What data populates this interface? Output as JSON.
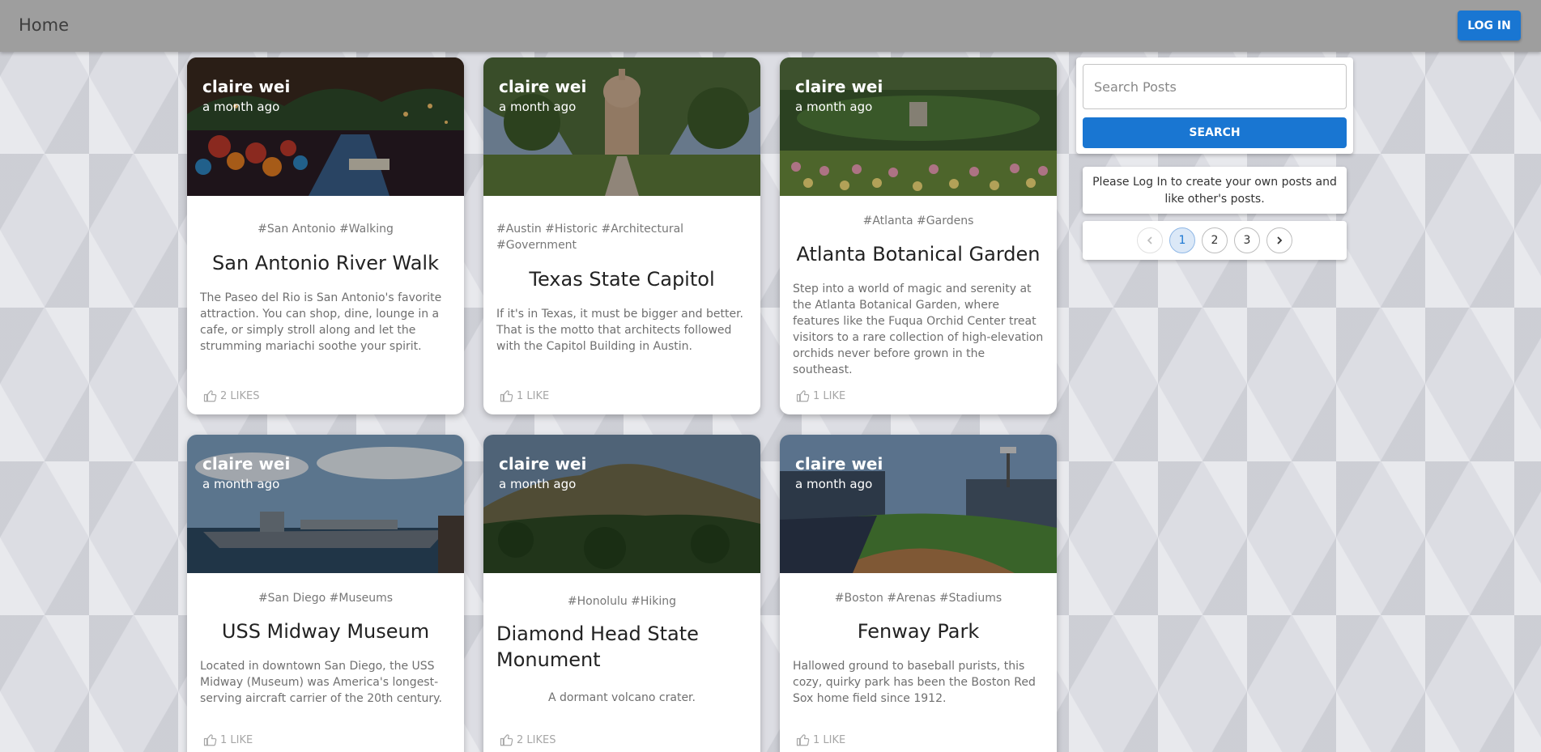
{
  "header": {
    "home_label": "Home",
    "login_label": "LOG IN"
  },
  "search": {
    "placeholder": "Search Posts",
    "button_label": "SEARCH"
  },
  "notice": "Please Log In to create your own posts and like other's posts.",
  "pagination": {
    "pages": [
      "1",
      "2",
      "3"
    ],
    "current": "1"
  },
  "posts": [
    {
      "author": "claire wei",
      "time": "a month ago",
      "tags": "#San Antonio #Walking",
      "title": "San Antonio River Walk",
      "description": "The Paseo del Rio is San Antonio's favorite attraction. You can shop, dine, lounge in a cafe, or simply stroll along and let the strumming mariachi soothe your spirit.",
      "likes": "2 LIKES",
      "image": "river-walk-night"
    },
    {
      "author": "claire wei",
      "time": "a month ago",
      "tags": "#Austin #Historic #Architectural #Government",
      "title": "Texas State Capitol",
      "description": "If it's in Texas, it must be bigger and better. That is the motto that architects followed with the Capitol Building in Austin.",
      "likes": "1 LIKE",
      "image": "capitol-dome"
    },
    {
      "author": "claire wei",
      "time": "a month ago",
      "tags": "#Atlanta #Gardens",
      "title": "Atlanta Botanical Garden",
      "description": "Step into a world of magic and serenity at the Atlanta Botanical Garden, where features like the Fuqua Orchid Center treat visitors to a rare collection of high-elevation orchids never before grown in the southeast.",
      "likes": "1 LIKE",
      "image": "tulip-garden"
    },
    {
      "author": "claire wei",
      "time": "a month ago",
      "tags": "#San Diego #Museums",
      "title": "USS Midway Museum",
      "description": "Located in downtown San Diego, the USS Midway (Museum) was America's longest-serving aircraft carrier of the 20th century.",
      "likes": "1 LIKE",
      "image": "aircraft-carrier"
    },
    {
      "author": "claire wei",
      "time": "a month ago",
      "tags": "#Honolulu #Hiking",
      "title": "Diamond Head State Monument",
      "description": "A dormant volcano crater.",
      "likes": "2 LIKES",
      "image": "volcano-crater"
    },
    {
      "author": "claire wei",
      "time": "a month ago",
      "tags": "#Boston #Arenas #Stadiums",
      "title": "Fenway Park",
      "description": "Hallowed ground to baseball purists, this cozy, quirky park has been the Boston Red Sox home field since 1912.",
      "likes": "1 LIKE",
      "image": "baseball-stadium"
    }
  ],
  "colors": {
    "primary": "#1976d2",
    "appbar": "#9e9e9e"
  }
}
